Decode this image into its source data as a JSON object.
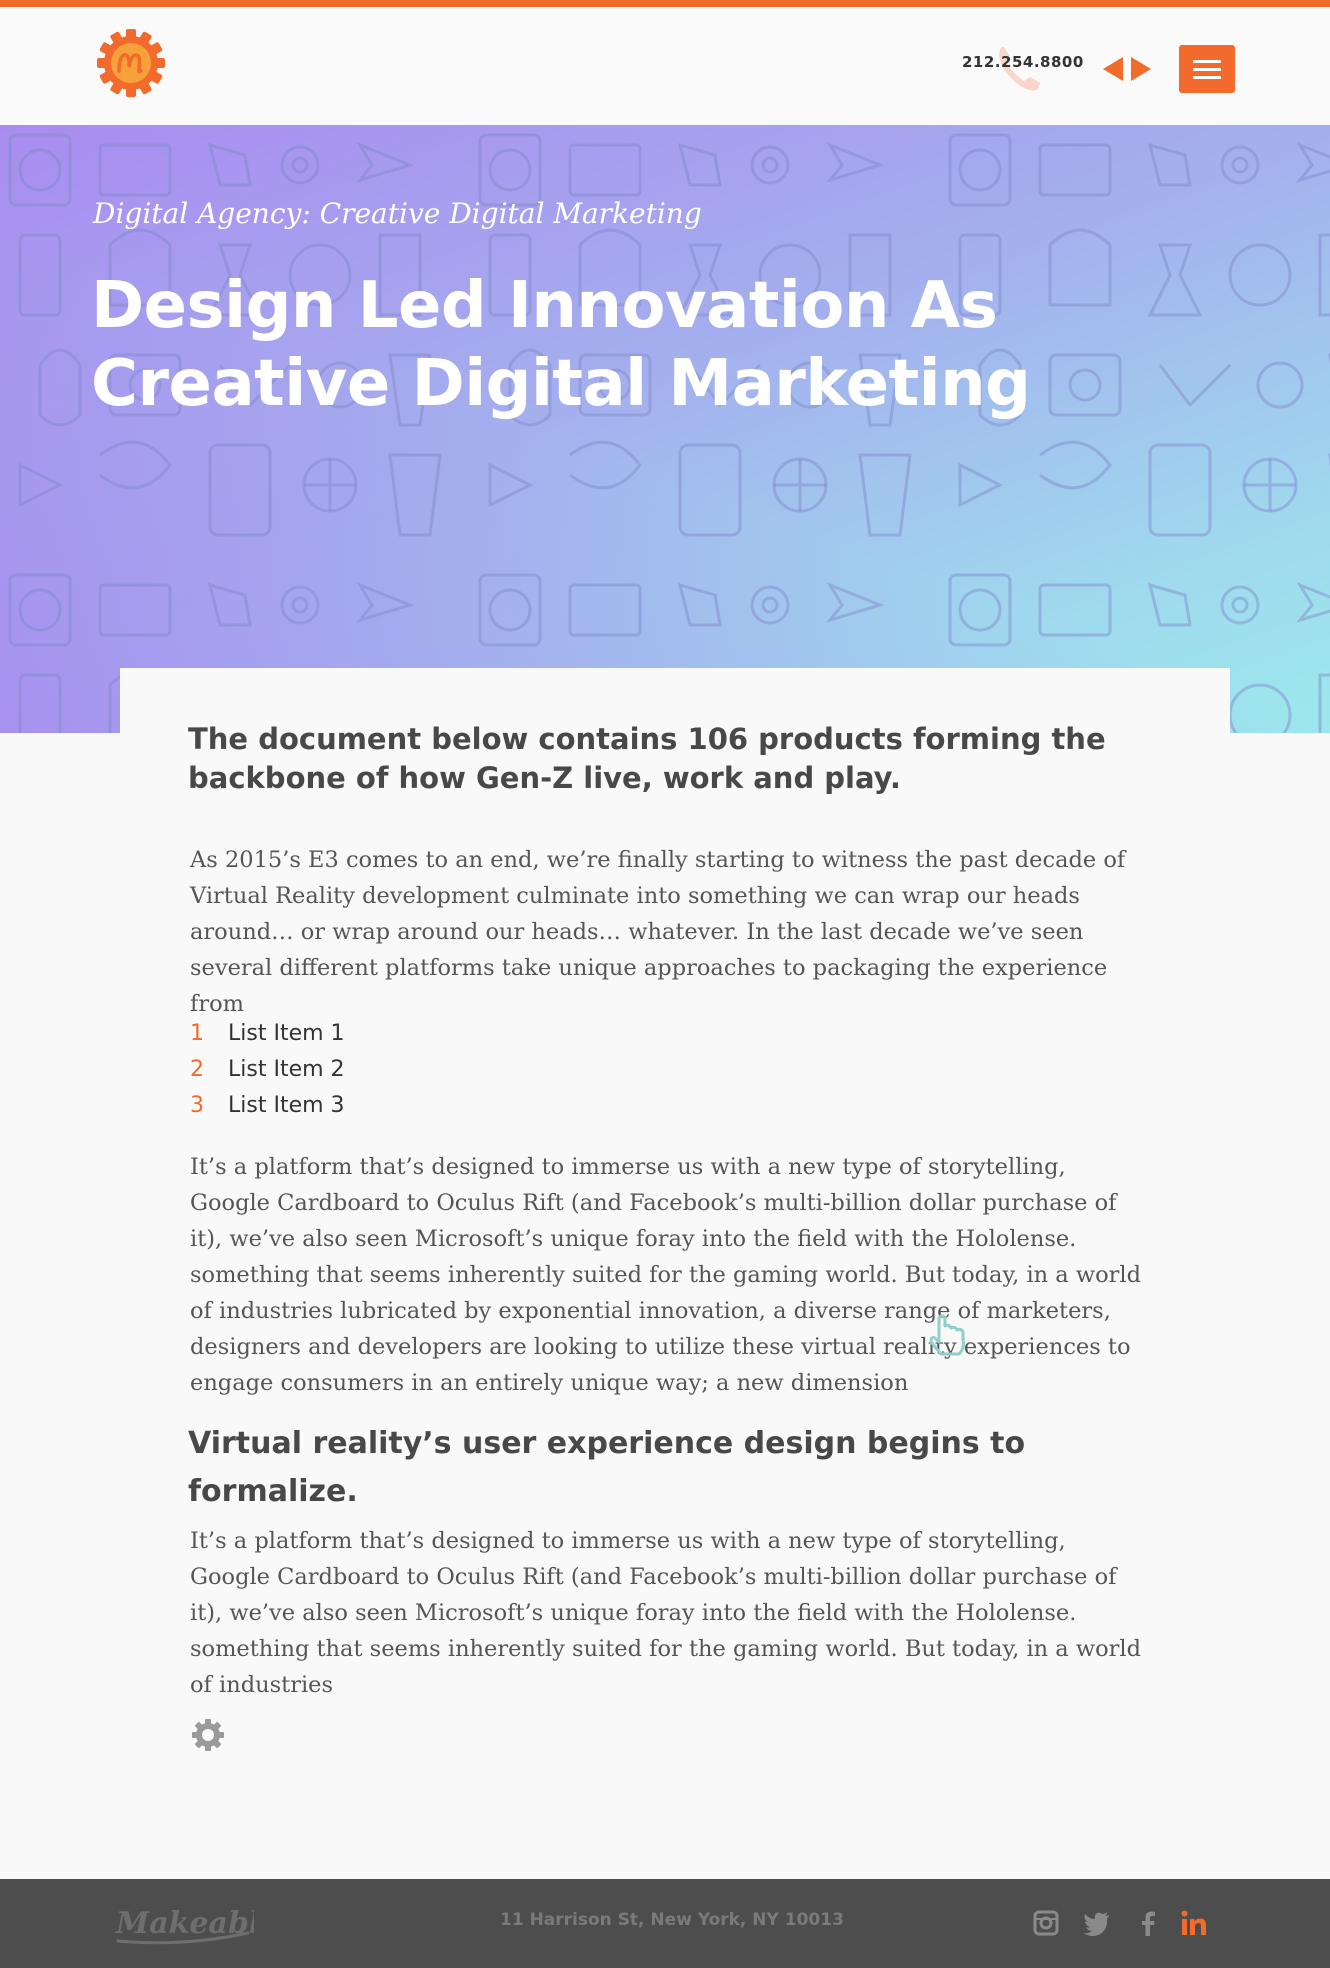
{
  "header": {
    "phone": "212.254.8800",
    "accent_color": "#f26b2c",
    "logo_icon": "gear-logo-icon",
    "menu_icon": "hamburger-icon"
  },
  "hero": {
    "eyebrow": "Digital Agency: Creative Digital Marketing",
    "title_line1": "Design Led Innovation As",
    "title_line2": "Creative Digital Marketing",
    "gradient_colors": [
      "#a98cf0",
      "#9ce8ec"
    ]
  },
  "article": {
    "lead": "The document below contains 106 products forming the backbone of how Gen-Z live, work and play.",
    "paragraph1": "As 2015’s E3 comes to an end, we’re finally starting to witness the past decade of Virtual Reality development culminate into something we can wrap our heads around… or wrap around our heads… whatever. In the last decade we’ve seen several different platforms take unique approaches to packaging the experience from",
    "list": [
      {
        "num": "1",
        "label": "List Item 1"
      },
      {
        "num": "2",
        "label": "List Item 2"
      },
      {
        "num": "3",
        "label": "List Item 3"
      }
    ],
    "paragraph2": "It’s a platform that’s designed to immerse us with a new type of storytelling, Google Cardboard to Oculus Rift (and Facebook’s multi-billion dollar purchase of it), we’ve also seen Microsoft’s unique foray into the field with the Hololense. something that seems inherently suited for the gaming world. But today, in a world of industries lubricated by exponential innovation, a diverse range of marketers, designers and developers are looking to utilize these virtual reality experiences to engage consumers in an entirely unique way; a new dimension",
    "subhead": "Virtual reality’s user experience design begins to formalize.",
    "paragraph3": "It’s a platform that’s designed to immerse us with a new type of storytelling, Google Cardboard to Oculus Rift (and Facebook’s multi-billion dollar purchase of it), we’ve also seen Microsoft’s unique foray into the field with the Hololense. something that seems inherently suited for the gaming world. But today, in a world of industries"
  },
  "footer": {
    "logo_text": "Makeable",
    "address": "11 Harrison St, New York, NY 10013",
    "social": [
      "instagram-icon",
      "twitter-icon",
      "facebook-icon",
      "linkedin-icon"
    ]
  }
}
